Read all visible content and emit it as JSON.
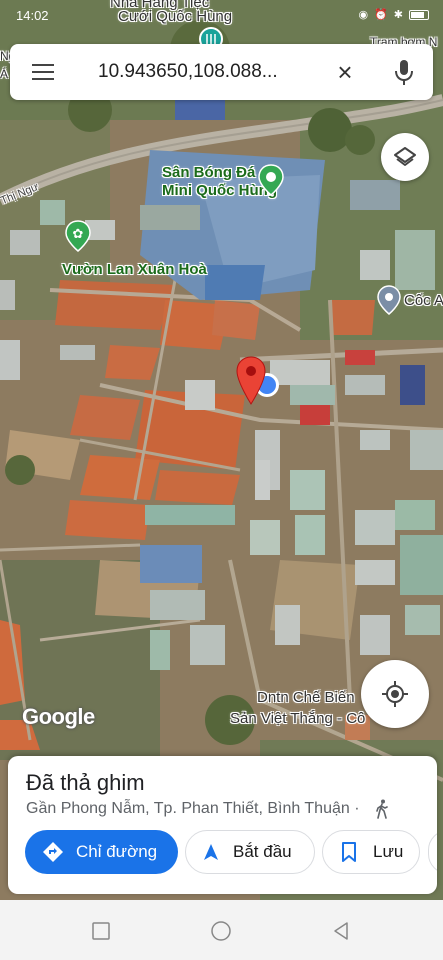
{
  "status_bar": {
    "time": "14:02"
  },
  "search": {
    "query": "10.943650,108.088..."
  },
  "map": {
    "labels": {
      "top_place": "Nhà Hàng Tiệc",
      "top_place_2": "Cưới Quốc Hùng",
      "top_right": "Trạm bơm N",
      "stadium_1": "Sân Bóng Đá",
      "stadium_2": "Mini Quốc Hùng",
      "garden": "Vườn Lan Xuân Hoà",
      "road": "Thị Ngư",
      "right_place": "Cốc A",
      "bottom_place_1": "Dntn Chế Biến",
      "bottom_place_2": "Sản Việt Thắng - Cô",
      "left_edge": "Ng",
      "left_edge_2": "Á"
    },
    "logo": "Google"
  },
  "sheet": {
    "title": "Đã thả ghim",
    "subtitle": "Gần Phong Nẫm, Tp. Phan Thiết, Bình Thuận ·",
    "directions_label": "Chỉ đường",
    "start_label": "Bắt đầu",
    "save_label": "Lưu"
  },
  "colors": {
    "accent": "#1a73e8",
    "pin": "#ea4335",
    "place_green": "#34a853"
  }
}
